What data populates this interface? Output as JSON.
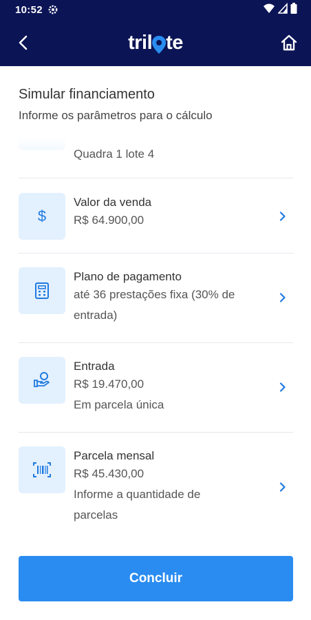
{
  "status_bar": {
    "time": "10:52"
  },
  "header": {
    "logo_text_left": "tril",
    "logo_text_right": "te"
  },
  "page": {
    "title": "Simular financiamento",
    "subtitle": "Informe os parâmetros para o cálculo"
  },
  "peek_item": {
    "text": "Quadra 1 lote 4"
  },
  "items": [
    {
      "label": "Valor da venda",
      "lines": [
        "R$ 64.900,00"
      ],
      "icon": "dollar-icon"
    },
    {
      "label": "Plano de pagamento",
      "lines": [
        "até 36 prestações fixa (30% de",
        "entrada)"
      ],
      "icon": "calculator-icon"
    },
    {
      "label": "Entrada",
      "lines": [
        "R$ 19.470,00",
        "Em parcela única"
      ],
      "icon": "hand-money-icon"
    },
    {
      "label": "Parcela mensal",
      "lines": [
        "R$ 45.430,00",
        "Informe a quantidade de",
        "parcelas"
      ],
      "icon": "barcode-icon"
    }
  ],
  "actions": {
    "submit_label": "Concluir"
  },
  "colors": {
    "header_bg": "#0b1455",
    "accent": "#2a8cf0",
    "icon_bg": "#e3f0fd",
    "icon_fg": "#1f7ae0"
  }
}
